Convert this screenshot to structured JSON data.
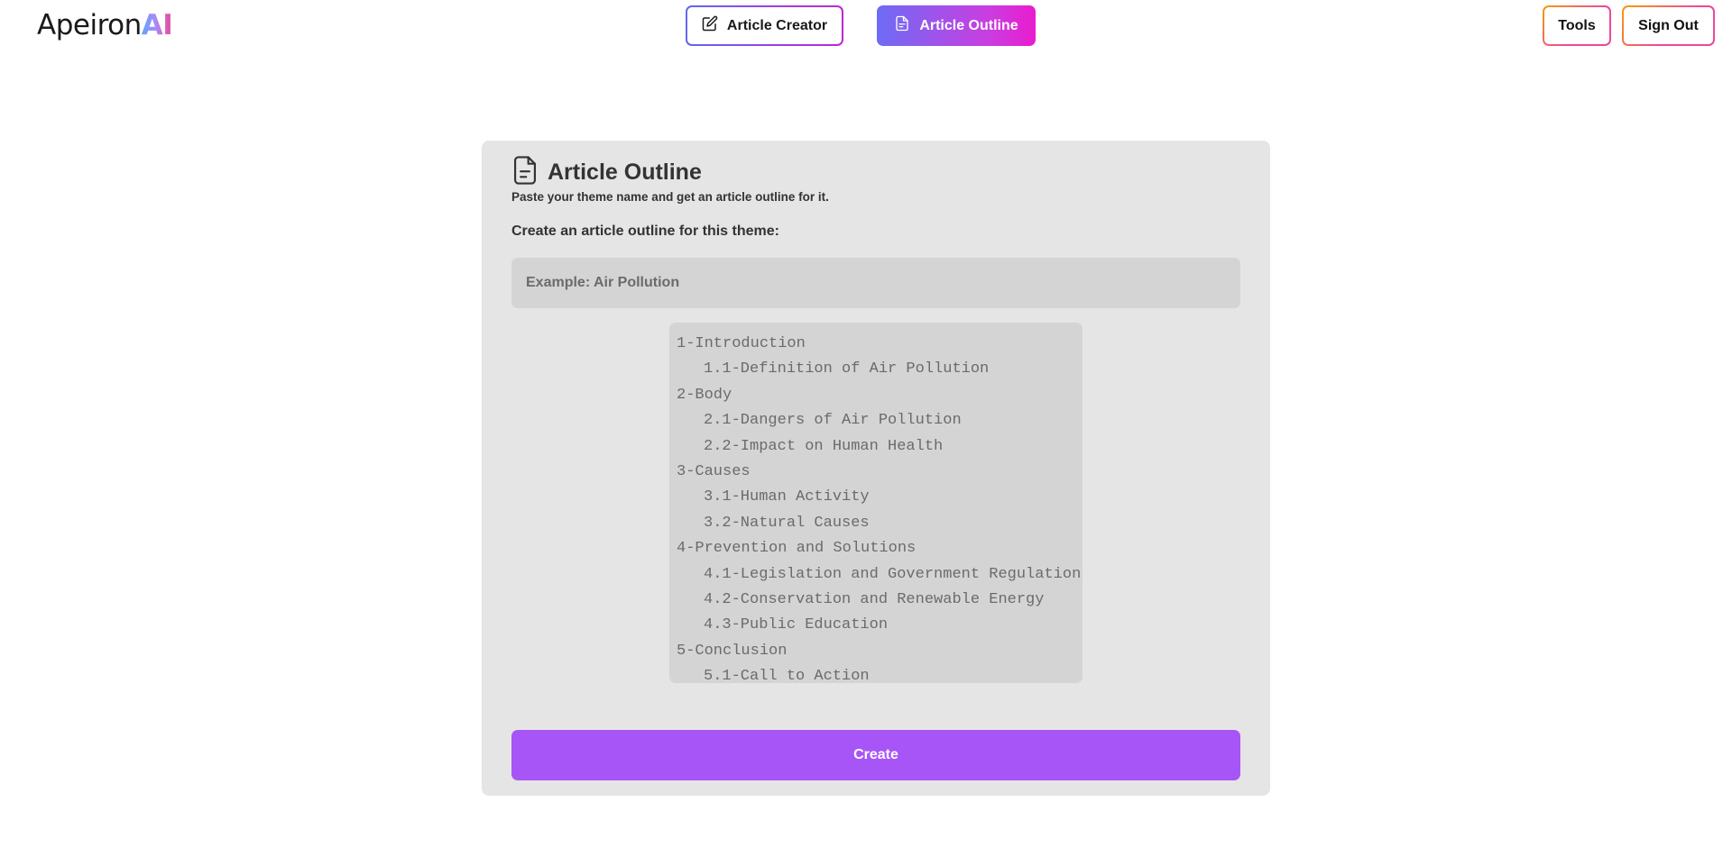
{
  "header": {
    "logo_text": "Apeiron",
    "logo_accent": "AI",
    "nav": {
      "article_creator_label": "Article Creator",
      "article_outline_label": "Article Outline"
    },
    "tools_label": "Tools",
    "sign_out_label": "Sign Out"
  },
  "card": {
    "icon": "document-icon",
    "title": "Article Outline",
    "subtitle": "Paste your theme name and get an article outline for it.",
    "field_label": "Create an article outline for this theme:",
    "input_placeholder": "Example: Air Pollution",
    "input_value": "",
    "outline": [
      {
        "text": "1-Introduction",
        "level": 0
      },
      {
        "text": "1.1-Definition of Air Pollution",
        "level": 1
      },
      {
        "text": "2-Body",
        "level": 0
      },
      {
        "text": "2.1-Dangers of Air Pollution",
        "level": 1
      },
      {
        "text": "2.2-Impact on Human Health",
        "level": 1
      },
      {
        "text": "3-Causes",
        "level": 0
      },
      {
        "text": "3.1-Human Activity",
        "level": 1
      },
      {
        "text": "3.2-Natural Causes",
        "level": 1
      },
      {
        "text": "4-Prevention and Solutions",
        "level": 0
      },
      {
        "text": "4.1-Legislation and Government Regulation",
        "level": 1
      },
      {
        "text": "4.2-Conservation and Renewable Energy",
        "level": 1
      },
      {
        "text": "4.3-Public Education",
        "level": 1
      },
      {
        "text": "5-Conclusion",
        "level": 0
      },
      {
        "text": "5.1-Call to Action",
        "level": 1
      }
    ],
    "create_label": "Create"
  },
  "colors": {
    "page_background": "#ffffff",
    "card_background": "#e5e5e5",
    "field_background": "#d4d4d4",
    "create_button": "#a855f7",
    "active_nav_gradient_start": "#6d6cf5",
    "active_nav_gradient_end": "#e91ccf"
  }
}
